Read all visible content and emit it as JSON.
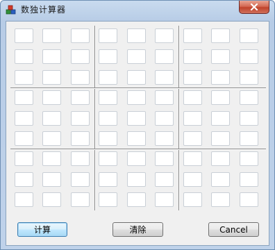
{
  "window": {
    "title": "数独计算器",
    "close_icon": "close-icon"
  },
  "grid": {
    "rows": 9,
    "cols": 9,
    "values": [
      [
        "",
        "",
        "",
        "",
        "",
        "",
        "",
        "",
        ""
      ],
      [
        "",
        "",
        "",
        "",
        "",
        "",
        "",
        "",
        ""
      ],
      [
        "",
        "",
        "",
        "",
        "",
        "",
        "",
        "",
        ""
      ],
      [
        "",
        "",
        "",
        "",
        "",
        "",
        "",
        "",
        ""
      ],
      [
        "",
        "",
        "",
        "",
        "",
        "",
        "",
        "",
        ""
      ],
      [
        "",
        "",
        "",
        "",
        "",
        "",
        "",
        "",
        ""
      ],
      [
        "",
        "",
        "",
        "",
        "",
        "",
        "",
        "",
        ""
      ],
      [
        "",
        "",
        "",
        "",
        "",
        "",
        "",
        "",
        ""
      ],
      [
        "",
        "",
        "",
        "",
        "",
        "",
        "",
        "",
        ""
      ]
    ]
  },
  "buttons": {
    "calculate": "计算",
    "clear": "清除",
    "cancel": "Cancel"
  }
}
